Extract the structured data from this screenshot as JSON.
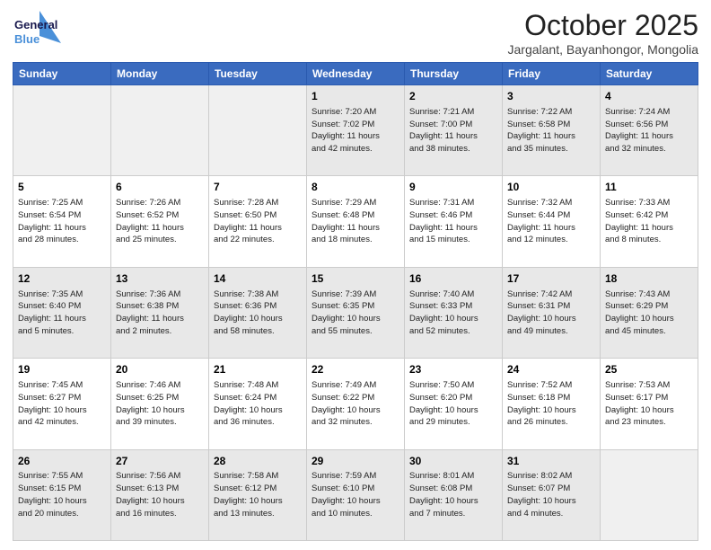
{
  "header": {
    "logo_line1": "General",
    "logo_line2": "Blue",
    "month": "October 2025",
    "location": "Jargalant, Bayanhongor, Mongolia"
  },
  "weekdays": [
    "Sunday",
    "Monday",
    "Tuesday",
    "Wednesday",
    "Thursday",
    "Friday",
    "Saturday"
  ],
  "weeks": [
    [
      {
        "day": "",
        "info": ""
      },
      {
        "day": "",
        "info": ""
      },
      {
        "day": "",
        "info": ""
      },
      {
        "day": "1",
        "info": "Sunrise: 7:20 AM\nSunset: 7:02 PM\nDaylight: 11 hours\nand 42 minutes."
      },
      {
        "day": "2",
        "info": "Sunrise: 7:21 AM\nSunset: 7:00 PM\nDaylight: 11 hours\nand 38 minutes."
      },
      {
        "day": "3",
        "info": "Sunrise: 7:22 AM\nSunset: 6:58 PM\nDaylight: 11 hours\nand 35 minutes."
      },
      {
        "day": "4",
        "info": "Sunrise: 7:24 AM\nSunset: 6:56 PM\nDaylight: 11 hours\nand 32 minutes."
      }
    ],
    [
      {
        "day": "5",
        "info": "Sunrise: 7:25 AM\nSunset: 6:54 PM\nDaylight: 11 hours\nand 28 minutes."
      },
      {
        "day": "6",
        "info": "Sunrise: 7:26 AM\nSunset: 6:52 PM\nDaylight: 11 hours\nand 25 minutes."
      },
      {
        "day": "7",
        "info": "Sunrise: 7:28 AM\nSunset: 6:50 PM\nDaylight: 11 hours\nand 22 minutes."
      },
      {
        "day": "8",
        "info": "Sunrise: 7:29 AM\nSunset: 6:48 PM\nDaylight: 11 hours\nand 18 minutes."
      },
      {
        "day": "9",
        "info": "Sunrise: 7:31 AM\nSunset: 6:46 PM\nDaylight: 11 hours\nand 15 minutes."
      },
      {
        "day": "10",
        "info": "Sunrise: 7:32 AM\nSunset: 6:44 PM\nDaylight: 11 hours\nand 12 minutes."
      },
      {
        "day": "11",
        "info": "Sunrise: 7:33 AM\nSunset: 6:42 PM\nDaylight: 11 hours\nand 8 minutes."
      }
    ],
    [
      {
        "day": "12",
        "info": "Sunrise: 7:35 AM\nSunset: 6:40 PM\nDaylight: 11 hours\nand 5 minutes."
      },
      {
        "day": "13",
        "info": "Sunrise: 7:36 AM\nSunset: 6:38 PM\nDaylight: 11 hours\nand 2 minutes."
      },
      {
        "day": "14",
        "info": "Sunrise: 7:38 AM\nSunset: 6:36 PM\nDaylight: 10 hours\nand 58 minutes."
      },
      {
        "day": "15",
        "info": "Sunrise: 7:39 AM\nSunset: 6:35 PM\nDaylight: 10 hours\nand 55 minutes."
      },
      {
        "day": "16",
        "info": "Sunrise: 7:40 AM\nSunset: 6:33 PM\nDaylight: 10 hours\nand 52 minutes."
      },
      {
        "day": "17",
        "info": "Sunrise: 7:42 AM\nSunset: 6:31 PM\nDaylight: 10 hours\nand 49 minutes."
      },
      {
        "day": "18",
        "info": "Sunrise: 7:43 AM\nSunset: 6:29 PM\nDaylight: 10 hours\nand 45 minutes."
      }
    ],
    [
      {
        "day": "19",
        "info": "Sunrise: 7:45 AM\nSunset: 6:27 PM\nDaylight: 10 hours\nand 42 minutes."
      },
      {
        "day": "20",
        "info": "Sunrise: 7:46 AM\nSunset: 6:25 PM\nDaylight: 10 hours\nand 39 minutes."
      },
      {
        "day": "21",
        "info": "Sunrise: 7:48 AM\nSunset: 6:24 PM\nDaylight: 10 hours\nand 36 minutes."
      },
      {
        "day": "22",
        "info": "Sunrise: 7:49 AM\nSunset: 6:22 PM\nDaylight: 10 hours\nand 32 minutes."
      },
      {
        "day": "23",
        "info": "Sunrise: 7:50 AM\nSunset: 6:20 PM\nDaylight: 10 hours\nand 29 minutes."
      },
      {
        "day": "24",
        "info": "Sunrise: 7:52 AM\nSunset: 6:18 PM\nDaylight: 10 hours\nand 26 minutes."
      },
      {
        "day": "25",
        "info": "Sunrise: 7:53 AM\nSunset: 6:17 PM\nDaylight: 10 hours\nand 23 minutes."
      }
    ],
    [
      {
        "day": "26",
        "info": "Sunrise: 7:55 AM\nSunset: 6:15 PM\nDaylight: 10 hours\nand 20 minutes."
      },
      {
        "day": "27",
        "info": "Sunrise: 7:56 AM\nSunset: 6:13 PM\nDaylight: 10 hours\nand 16 minutes."
      },
      {
        "day": "28",
        "info": "Sunrise: 7:58 AM\nSunset: 6:12 PM\nDaylight: 10 hours\nand 13 minutes."
      },
      {
        "day": "29",
        "info": "Sunrise: 7:59 AM\nSunset: 6:10 PM\nDaylight: 10 hours\nand 10 minutes."
      },
      {
        "day": "30",
        "info": "Sunrise: 8:01 AM\nSunset: 6:08 PM\nDaylight: 10 hours\nand 7 minutes."
      },
      {
        "day": "31",
        "info": "Sunrise: 8:02 AM\nSunset: 6:07 PM\nDaylight: 10 hours\nand 4 minutes."
      },
      {
        "day": "",
        "info": ""
      }
    ]
  ],
  "shaded_rows": [
    0,
    2,
    4
  ],
  "colors": {
    "header_bg": "#3a6bbf",
    "shaded_cell": "#e8e8e8",
    "empty_cell": "#f0f0f0"
  }
}
